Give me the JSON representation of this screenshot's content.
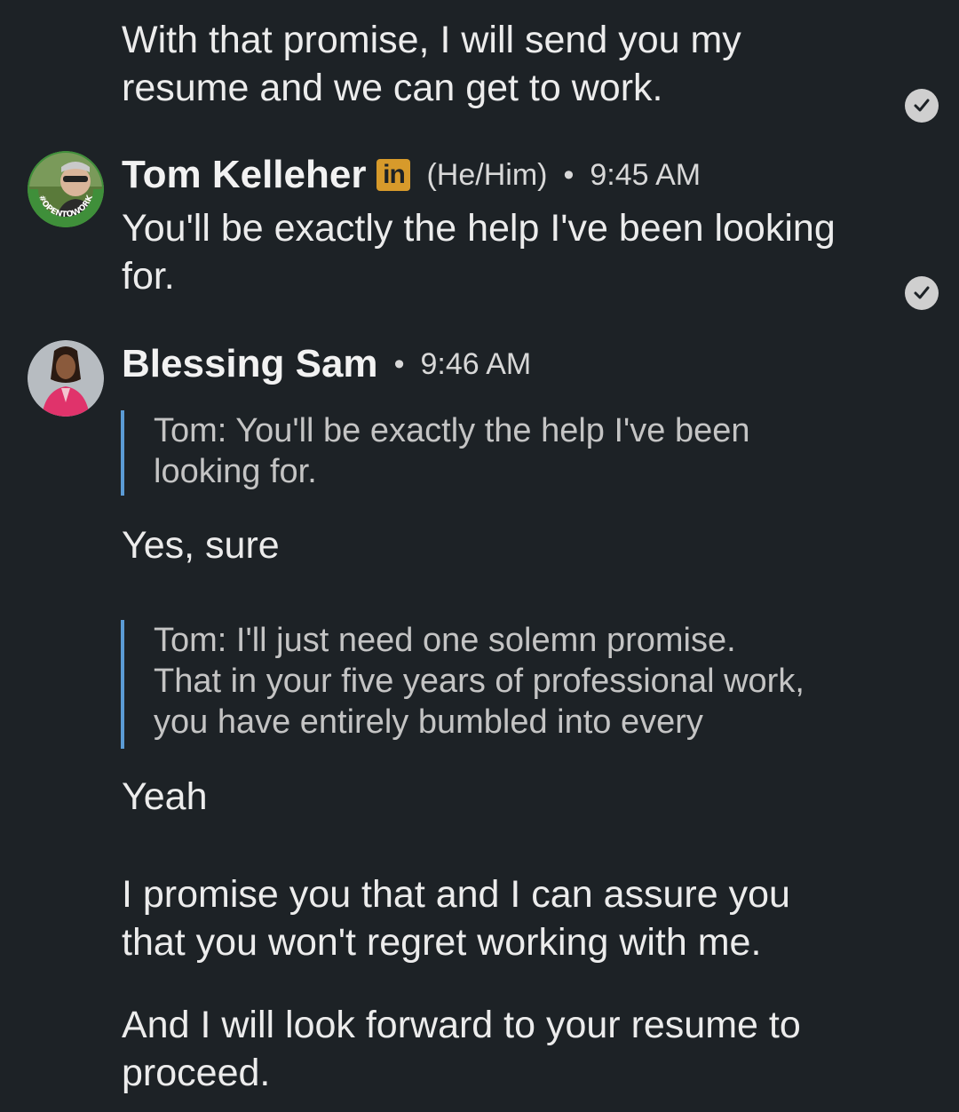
{
  "messages": {
    "m1_text": "With that promise, I will send you my\nresume and we can get to work.",
    "tom": {
      "name": "Tom Kelleher",
      "badge": "in",
      "pronouns": "(He/Him)",
      "dot": "•",
      "time": "9:45 AM",
      "text": "You'll be exactly the help I've been looking\nfor.",
      "avatar_ring_text": "#OPENTOWORK"
    },
    "blessing": {
      "name": "Blessing Sam",
      "dot": "•",
      "time": "9:46 AM",
      "quote1": "Tom: You'll be exactly the help I've been\nlooking for.",
      "reply1": "Yes, sure",
      "quote2": "Tom: I'll just need one solemn promise.\nThat in your five years of professional work,\nyou have entirely bumbled into every",
      "reply2": "Yeah",
      "reply3": "I promise you that and I can assure you\nthat you won't regret working with me.",
      "reply4": "And I will look forward to your resume to\nproceed."
    }
  },
  "icons": {
    "read_receipt": "check-circle-icon",
    "linkedin_badge": "linkedin-icon"
  },
  "colors": {
    "background": "#1d2226",
    "quote_bar": "#5b9bd5",
    "linkedin_badge": "#d79a2b",
    "open_to_work_ring": "#3f8f3a"
  }
}
